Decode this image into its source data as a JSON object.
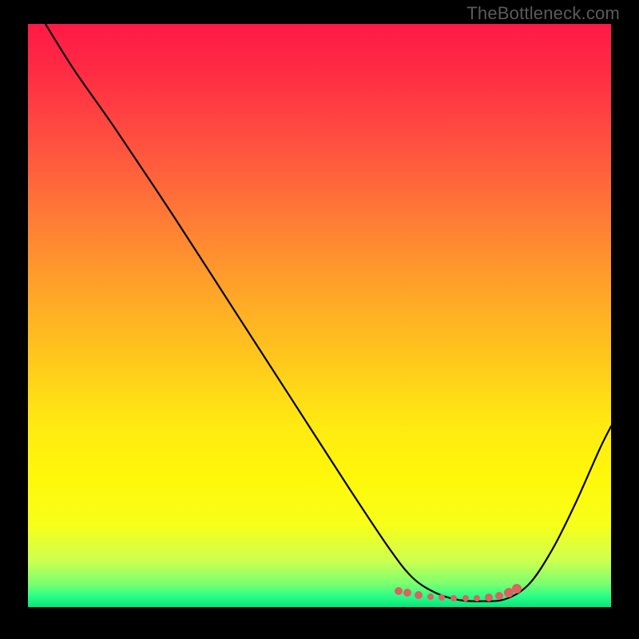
{
  "watermark": "TheBottleneck.com",
  "chart_data": {
    "type": "line",
    "title": "",
    "xlabel": "",
    "ylabel": "",
    "xlim": [
      0,
      100
    ],
    "ylim": [
      0,
      100
    ],
    "series": [
      {
        "name": "curve",
        "x": [
          3,
          8,
          15,
          25,
          35,
          45,
          55,
          62,
          66,
          70,
          74,
          78,
          82,
          86,
          90,
          94,
          98,
          100
        ],
        "y": [
          100,
          92,
          82,
          67,
          51.5,
          36,
          20.5,
          10,
          5,
          2.4,
          1.2,
          1.0,
          1.4,
          4,
          10,
          18,
          27,
          31
        ]
      }
    ],
    "dots": {
      "name": "highlight-dots",
      "points": [
        {
          "x": 63.5,
          "y": 2.7,
          "r": 5
        },
        {
          "x": 65.0,
          "y": 2.4,
          "r": 5
        },
        {
          "x": 67.0,
          "y": 2.1,
          "r": 5
        },
        {
          "x": 69.0,
          "y": 1.8,
          "r": 4
        },
        {
          "x": 71.0,
          "y": 1.6,
          "r": 4
        },
        {
          "x": 73.0,
          "y": 1.5,
          "r": 4
        },
        {
          "x": 75.0,
          "y": 1.5,
          "r": 4
        },
        {
          "x": 77.0,
          "y": 1.5,
          "r": 4
        },
        {
          "x": 79.0,
          "y": 1.6,
          "r": 5
        },
        {
          "x": 80.8,
          "y": 1.9,
          "r": 5
        },
        {
          "x": 82.5,
          "y": 2.5,
          "r": 6
        },
        {
          "x": 83.8,
          "y": 3.1,
          "r": 6
        }
      ]
    },
    "gradient_stops": [
      {
        "pos": 0,
        "color": "#ff1a46"
      },
      {
        "pos": 50,
        "color": "#ffb822"
      },
      {
        "pos": 85,
        "color": "#faff18"
      },
      {
        "pos": 100,
        "color": "#06e67a"
      }
    ]
  }
}
